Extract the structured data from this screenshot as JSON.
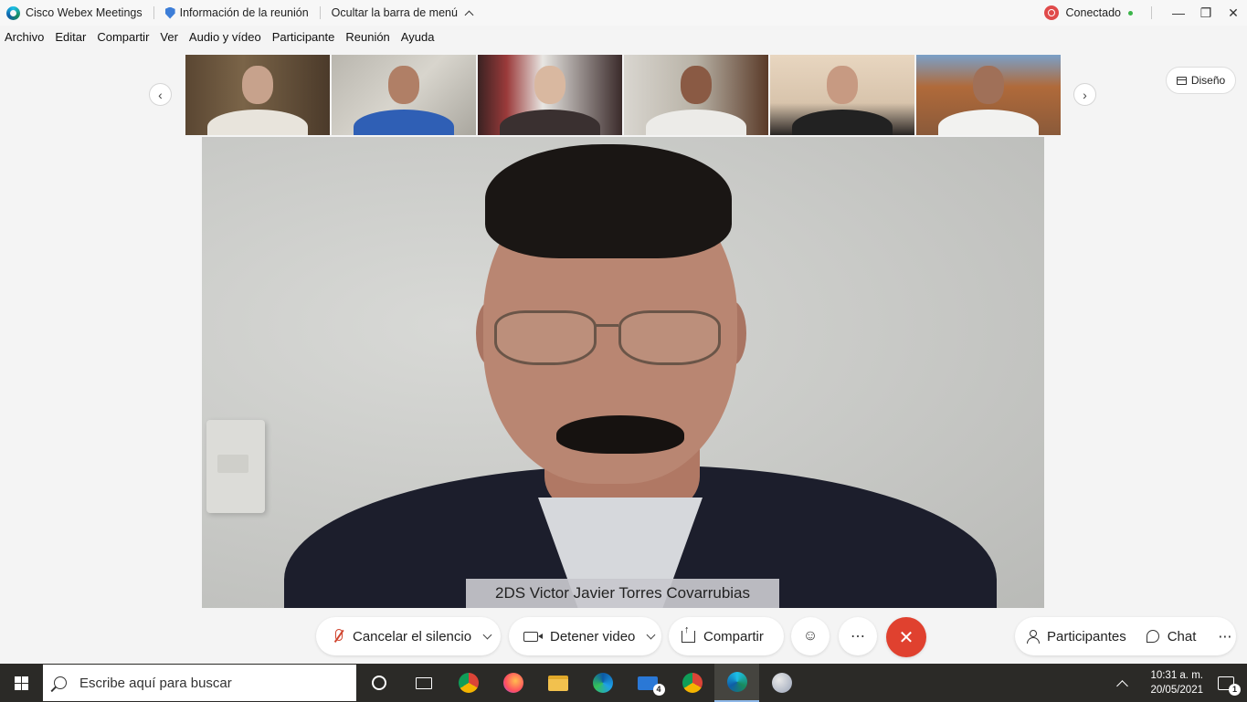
{
  "titlebar": {
    "app_name": "Cisco Webex Meetings",
    "meeting_info": "Información de la reunión",
    "hide_menu": "Ocultar la barra de menú",
    "status": "Conectado",
    "minimize": "—",
    "restore": "❐",
    "close": "✕"
  },
  "menu": {
    "items": [
      "Archivo",
      "Editar",
      "Compartir",
      "Ver",
      "Audio y vídeo",
      "Participante",
      "Reunión",
      "Ayuda"
    ]
  },
  "layout_button": "Diseño",
  "main_video": {
    "speaker_name": "2DS Victor Javier Torres Covarrubias"
  },
  "controls": {
    "mute": "Cancelar el silencio",
    "video": "Detener video",
    "share": "Compartir",
    "participants": "Participantes",
    "chat": "Chat",
    "more": "⋯",
    "end_call": "✕",
    "reactions": "☺"
  },
  "taskbar": {
    "search_placeholder": "Escribe aquí para buscar",
    "mail_badge": "4",
    "time": "10:31 a. m.",
    "date": "20/05/2021",
    "notification_count": "1"
  },
  "colors": {
    "end_call": "#e0412f",
    "taskbar": "#2b2a27",
    "connected_dot": "#3bb54a"
  }
}
